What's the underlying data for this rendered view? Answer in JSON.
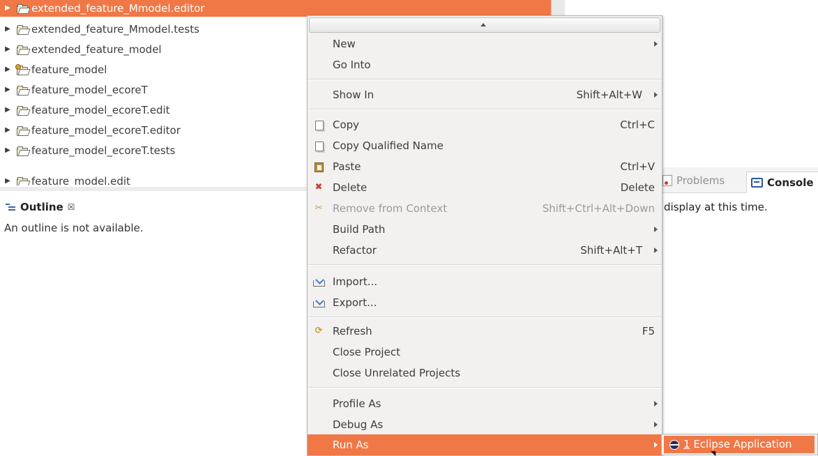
{
  "tree": {
    "projects": [
      {
        "label": "extended_feature_Mmodel.editor",
        "selected": true
      },
      {
        "label": "extended_feature_Mmodel.tests"
      },
      {
        "label": "extended_feature_model"
      },
      {
        "label": "feature_model"
      },
      {
        "label": "feature_model_ecoreT"
      },
      {
        "label": "feature_model_ecoreT.edit"
      },
      {
        "label": "feature_model_ecoreT.editor"
      },
      {
        "label": "feature_model_ecoreT.tests"
      },
      {
        "label": "feature_model.edit"
      }
    ]
  },
  "outline": {
    "title": "Outline",
    "close_glyph": "☒",
    "message": "An outline is not available."
  },
  "bottom_panel": {
    "tabs": [
      {
        "label": "Problems"
      },
      {
        "label": "Console"
      }
    ],
    "console_message": "display at this time."
  },
  "context_menu": {
    "items": [
      {
        "label": "New",
        "accel": "",
        "submenu": true
      },
      {
        "label": "Go Into",
        "accel": "",
        "submenu": false
      },
      {
        "label": "Show In",
        "accel": "Shift+Alt+W",
        "submenu": true
      },
      {
        "label": "Copy",
        "accel": "Ctrl+C",
        "icon": "copy-icon"
      },
      {
        "label": "Copy Qualified Name",
        "accel": "",
        "icon": "copy-qualified-name-icon"
      },
      {
        "label": "Paste",
        "accel": "Ctrl+V",
        "icon": "paste-icon"
      },
      {
        "label": "Delete",
        "accel": "Delete",
        "icon": "delete-icon"
      },
      {
        "label": "Remove from Context",
        "accel": "Shift+Ctrl+Alt+Down",
        "icon": "remove-from-context-icon",
        "disabled": true
      },
      {
        "label": "Build Path",
        "accel": "",
        "submenu": true
      },
      {
        "label": "Refactor",
        "accel": "Shift+Alt+T",
        "submenu": true
      },
      {
        "label": "Import...",
        "accel": "",
        "icon": "import-icon"
      },
      {
        "label": "Export...",
        "accel": "",
        "icon": "export-icon"
      },
      {
        "label": "Refresh",
        "accel": "F5",
        "icon": "refresh-icon"
      },
      {
        "label": "Close Project",
        "accel": ""
      },
      {
        "label": "Close Unrelated Projects",
        "accel": ""
      },
      {
        "label": "Profile As",
        "accel": "",
        "submenu": true
      },
      {
        "label": "Debug As",
        "accel": "",
        "submenu": true
      },
      {
        "label": "Run As",
        "accel": "",
        "submenu": true,
        "highlighted": true
      }
    ]
  },
  "run_as_submenu": {
    "mnemonic": "1",
    "label": " Eclipse Application"
  },
  "colors": {
    "selection": "#f07746",
    "menu_background": "#f2f1f0"
  }
}
